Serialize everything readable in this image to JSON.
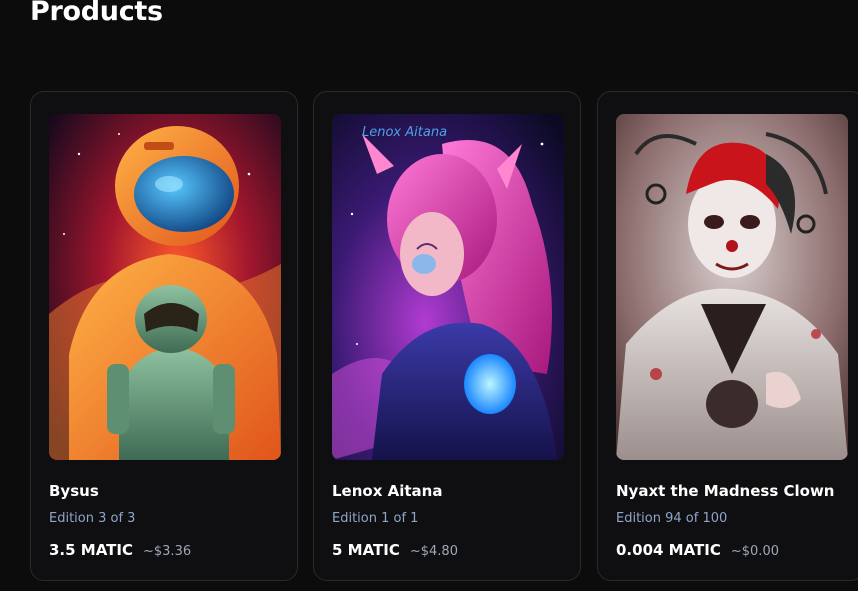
{
  "page": {
    "title": "Products"
  },
  "products": [
    {
      "name": "Bysus",
      "edition": "Edition 3 of 3",
      "price": "3.5 MATIC",
      "usd": "~$3.36",
      "image": "astronauts-art"
    },
    {
      "name": "Lenox Aitana",
      "edition": "Edition 1 of 1",
      "price": "5 MATIC",
      "usd": "~$4.80",
      "image": "space-elf-art",
      "image_caption": "Lenox Aitana"
    },
    {
      "name": "Nyaxt the Madness Clown",
      "edition": "Edition 94 of 100",
      "price": "0.004 MATIC",
      "usd": "~$0.00",
      "image": "madness-clown-art"
    }
  ],
  "colors": {
    "background": "#0c0c0d",
    "card_border": "#2a2a2e",
    "edition_text": "#8fa6c8",
    "usd_text": "#9ea7b6"
  }
}
